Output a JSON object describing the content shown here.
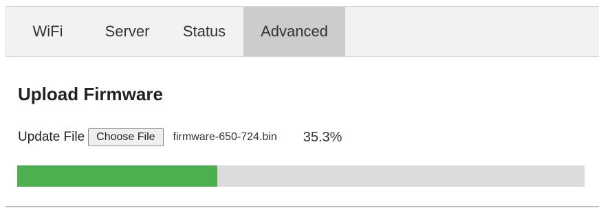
{
  "tabs": [
    {
      "label": "WiFi",
      "active": false
    },
    {
      "label": "Server",
      "active": false
    },
    {
      "label": "Status",
      "active": false
    },
    {
      "label": "Advanced",
      "active": true
    }
  ],
  "section": {
    "title": "Upload Firmware"
  },
  "upload": {
    "label": "Update File",
    "button_label": "Choose File",
    "filename": "firmware-650-724.bin",
    "percent_text": "35.3%",
    "progress_fraction": 0.353
  },
  "colors": {
    "progress_fill": "#4caf50",
    "progress_track": "#dcdcdc",
    "active_tab": "#cccccc",
    "tabbar_bg": "#f2f2f2"
  }
}
